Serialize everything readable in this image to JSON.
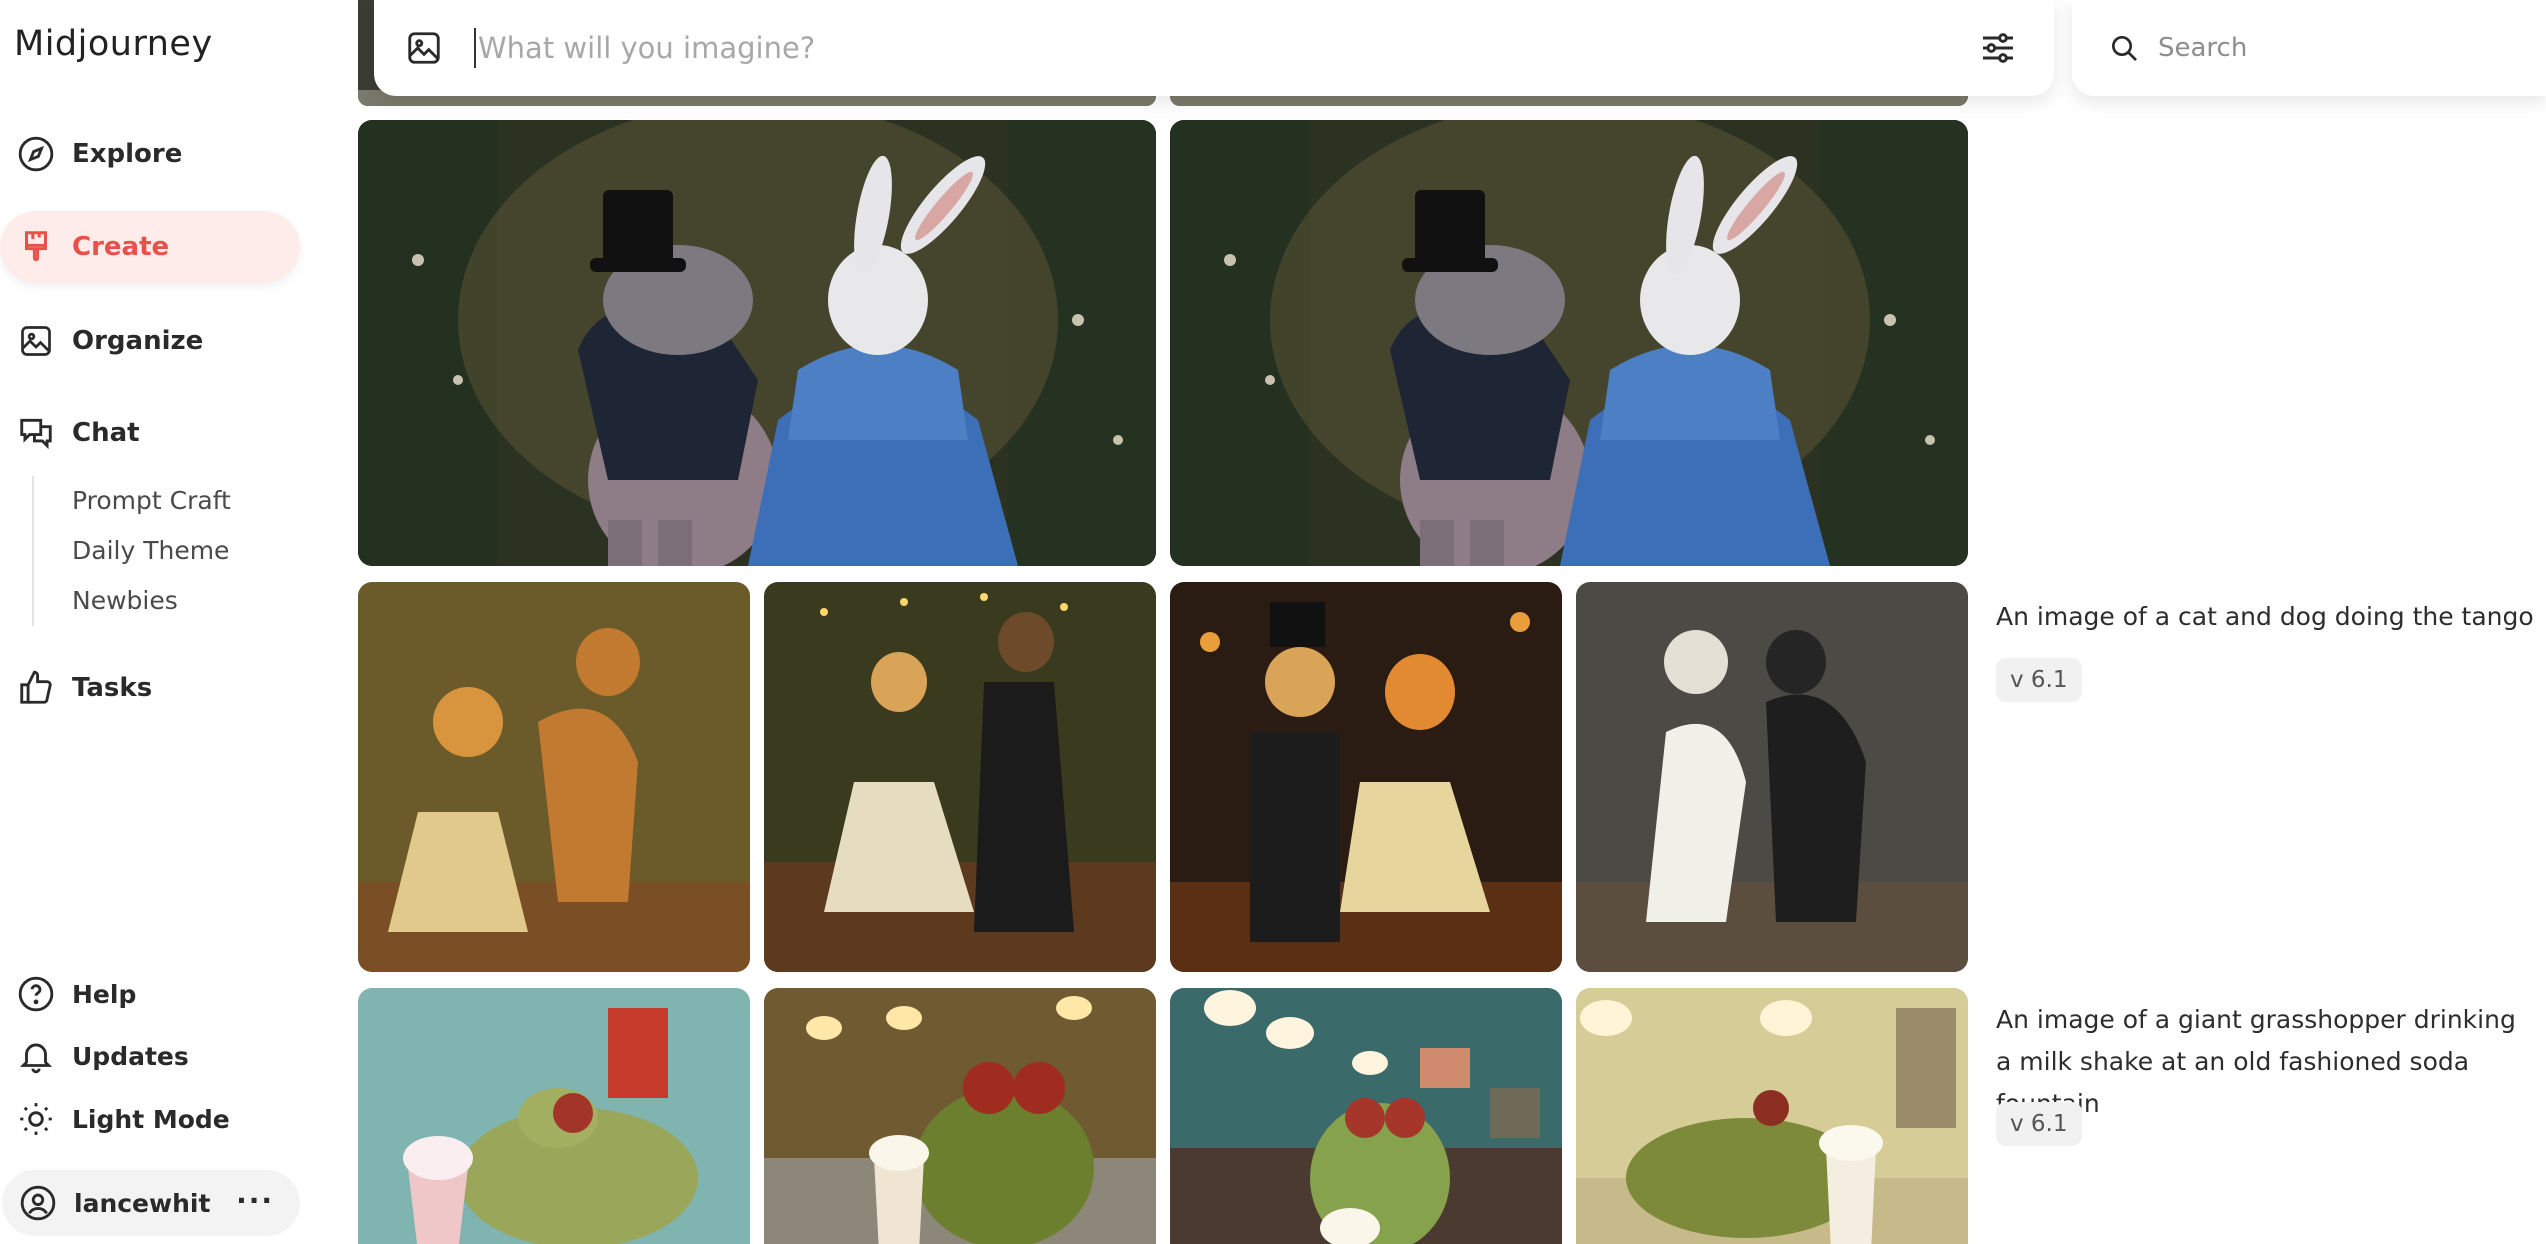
{
  "app": {
    "brand": "Midjourney"
  },
  "nav": {
    "explore": "Explore",
    "create": "Create",
    "organize": "Organize",
    "chat": "Chat",
    "chat_sub": [
      "Prompt Craft",
      "Daily Theme",
      "Newbies"
    ],
    "tasks": "Tasks"
  },
  "bottom_nav": {
    "help": "Help",
    "updates": "Updates",
    "light_mode": "Light Mode",
    "username": "lancewhit",
    "more": "···"
  },
  "prompt_bar": {
    "placeholder": "What will you imagine?"
  },
  "search": {
    "placeholder": "Search"
  },
  "jobs": [
    {
      "prompt": "",
      "version": "",
      "images": [
        "hippo-rabbit-dance",
        "hippo-rabbit-dance"
      ]
    },
    {
      "prompt": "An image of a cat and dog doing the tango",
      "version": "v 6.1",
      "images": [
        "cat-dog-tango-1",
        "cat-dog-tango-2",
        "cat-dog-tango-3",
        "cat-dog-tango-4"
      ]
    },
    {
      "prompt": "An image of a giant grasshopper drinking a milk shake at an old fashioned soda fountain",
      "version": "v 6.1",
      "images": [
        "grasshopper-milkshake-1",
        "grasshopper-milkshake-2",
        "grasshopper-milkshake-3",
        "grasshopper-milkshake-4"
      ]
    }
  ],
  "icons": {
    "explore": "compass-icon",
    "create": "paintbrush-icon",
    "organize": "gallery-icon",
    "chat": "chat-bubbles-icon",
    "tasks": "thumbs-up-icon",
    "help": "question-circle-icon",
    "updates": "bell-icon",
    "light_mode": "sun-icon",
    "user": "user-circle-icon",
    "prompt_image": "image-upload-icon",
    "settings": "sliders-icon",
    "search": "search-icon"
  },
  "colors": {
    "accent": "#e8504a",
    "active_bg": "#fdecea"
  }
}
